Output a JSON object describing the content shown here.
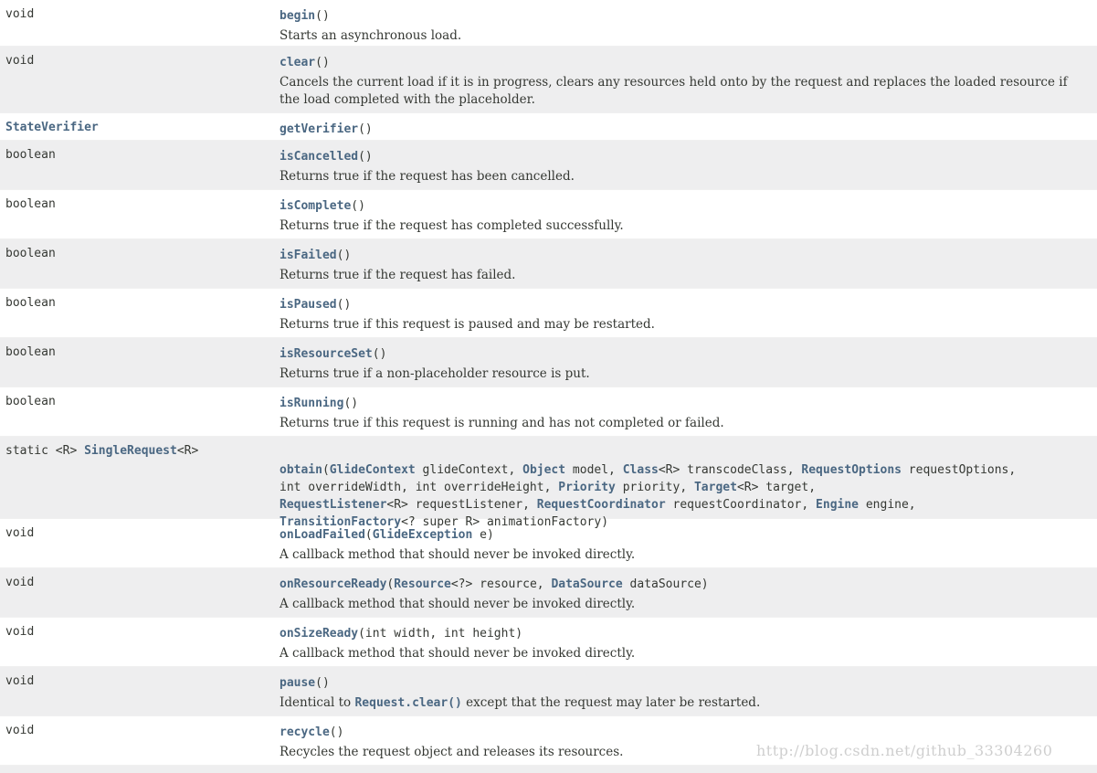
{
  "rows": [
    {
      "type": "void",
      "method": "begin",
      "desc": "Starts an asynchronous load."
    },
    {
      "type": "void",
      "method": "clear",
      "desc": "Cancels the current load if it is in progress, clears any resources held onto by the request and replaces the loaded resource if the load completed with the placeholder."
    },
    {
      "type": "StateVerifier",
      "method": "getVerifier"
    },
    {
      "type": "boolean",
      "method": "isCancelled",
      "desc": "Returns true if the request has been cancelled."
    },
    {
      "type": "boolean",
      "method": "isComplete",
      "desc": "Returns true if the request has completed successfully."
    },
    {
      "type": "boolean",
      "method": "isFailed",
      "desc": "Returns true if the request has failed."
    },
    {
      "type": "boolean",
      "method": "isPaused",
      "desc": "Returns true if this request is paused and may be restarted."
    },
    {
      "type": "boolean",
      "method": "isResourceSet",
      "desc": "Returns true if a non-placeholder resource is put."
    },
    {
      "type": "boolean",
      "method": "isRunning",
      "desc": "Returns true if this request is running and has not completed or failed."
    },
    {
      "type_prefix": "static <R> ",
      "type_link": "SingleRequest",
      "type_suffix": "<R>",
      "method": "obtain",
      "p": [
        "(",
        "GlideContext",
        " glideContext, ",
        "Object",
        " model, ",
        "Class",
        "<R> transcodeClass, ",
        "RequestOptions",
        " requestOptions,",
        "int overrideWidth, int overrideHeight, ",
        "Priority",
        " priority, ",
        "Target",
        "<R> target,",
        "RequestListener",
        "<R> requestListener, ",
        "RequestCoordinator",
        " requestCoordinator, ",
        "Engine",
        " engine,",
        "TransitionFactory",
        "<? super R> animationFactory)"
      ]
    },
    {
      "type": "void",
      "method": "onLoadFailed",
      "p": [
        "(",
        "GlideException",
        " e)"
      ],
      "desc": "A callback method that should never be invoked directly."
    },
    {
      "type": "void",
      "method": "onResourceReady",
      "p": [
        "(",
        "Resource",
        "<?> resource, ",
        "DataSource",
        " dataSource)"
      ],
      "desc": "A callback method that should never be invoked directly."
    },
    {
      "type": "void",
      "method": "onSizeReady",
      "p": [
        "(int width, int height)"
      ],
      "desc": "A callback method that should never be invoked directly."
    },
    {
      "type": "void",
      "method": "pause",
      "d": [
        "Identical to ",
        "Request.clear()",
        " except that the request may later be restarted."
      ]
    },
    {
      "type": "void",
      "method": "recycle",
      "desc": "Recycles the request object and releases its resources."
    }
  ],
  "empty_parens": "()",
  "watermark": "http://blog.csdn.net/github_33304260"
}
